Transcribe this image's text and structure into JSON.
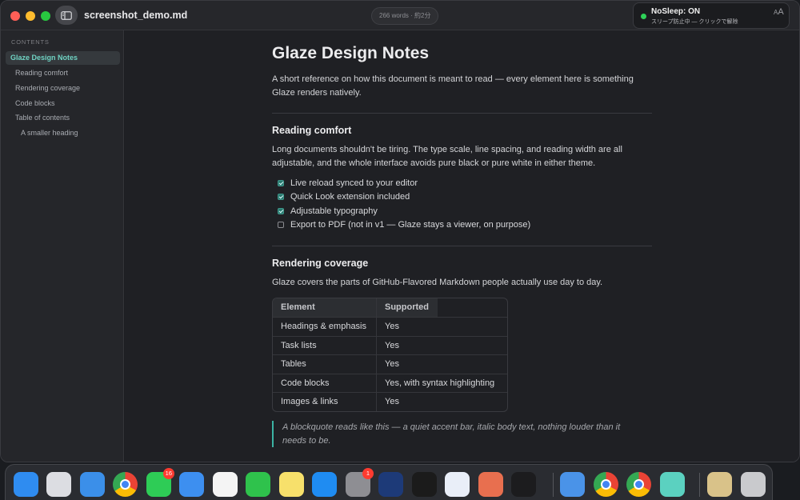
{
  "window": {
    "doc_title": "screenshot_demo.md",
    "word_count": "266 words · 約2分"
  },
  "notification": {
    "title": "NoSleep: ON",
    "subtitle": "スリープ防止中 — クリックで解除",
    "aa_big": "A",
    "aa_small": "A"
  },
  "sidebar": {
    "heading": "CONTENTS",
    "items": [
      {
        "label": "Glaze Design Notes"
      },
      {
        "label": "Reading comfort"
      },
      {
        "label": "Rendering coverage"
      },
      {
        "label": "Code blocks"
      },
      {
        "label": "Table of contents"
      },
      {
        "label": "A smaller heading"
      }
    ]
  },
  "doc": {
    "h1": "Glaze Design Notes",
    "intro_line1": "A short reference on how this document is meant to read — every element here is something",
    "intro_line2": "Glaze renders natively.",
    "reading": {
      "heading": "Reading comfort",
      "para_line1": "Long documents shouldn't be tiring. The type scale, line spacing, and reading width are all",
      "para_line2": "adjustable, and the whole interface avoids pure black or pure white in either theme.",
      "tasks": [
        {
          "label": "Live reload synced to your editor",
          "checked": true
        },
        {
          "label": "Quick Look extension included",
          "checked": true
        },
        {
          "label": "Adjustable typography",
          "checked": true
        },
        {
          "label": "Export to PDF (not in v1 — Glaze stays a viewer, on purpose)",
          "checked": false
        }
      ]
    },
    "rendering": {
      "heading": "Rendering coverage",
      "para": "Glaze covers the parts of GitHub-Flavored Markdown people actually use day to day.",
      "table": {
        "headers": [
          "Element",
          "Supported"
        ],
        "rows": [
          [
            "Headings & emphasis",
            "Yes"
          ],
          [
            "Task lists",
            "Yes"
          ],
          [
            "Tables",
            "Yes"
          ],
          [
            "Code blocks",
            "Yes, with syntax highlighting"
          ],
          [
            "Images & links",
            "Yes"
          ]
        ]
      }
    },
    "quote_line1": "A blockquote reads like this — a quiet accent bar, italic body text, nothing louder than it",
    "quote_line2": "needs to be."
  },
  "dock": {
    "apps": [
      {
        "icon": "finder-icon",
        "color": "#2f8cf0"
      },
      {
        "icon": "launchpad-icon",
        "color": "#dcdde2"
      },
      {
        "icon": "safari-icon",
        "color": "#3b8fe9"
      },
      {
        "icon": "chrome-icon",
        "color": "#e8e8e8"
      },
      {
        "icon": "messages-icon",
        "color": "#2ecc56",
        "badge": "16"
      },
      {
        "icon": "mail-icon",
        "color": "#3d8ff0"
      },
      {
        "icon": "photos-icon",
        "color": "#f4f4f4"
      },
      {
        "icon": "facetime-icon",
        "color": "#2fc24c"
      },
      {
        "icon": "notes-icon",
        "color": "#f7e06b"
      },
      {
        "icon": "app-store-icon",
        "color": "#1f8cf2"
      },
      {
        "icon": "system-settings-icon",
        "color": "#8e8e93",
        "badge": "1"
      },
      {
        "icon": "apple-configurator-icon",
        "color": "#1d3a78"
      },
      {
        "icon": "terminal-icon",
        "color": "#1b1b1b"
      },
      {
        "icon": "1password-icon",
        "color": "#e9eef8"
      },
      {
        "icon": "claude-icon",
        "color": "#e86f4f"
      },
      {
        "icon": "dots-app-icon",
        "color": "#1c1c1e"
      },
      {
        "icon": "xcode-sim-icon",
        "color": "#4a93e8"
      },
      {
        "icon": "chrome-icon-2",
        "color": "#e8e8e8"
      },
      {
        "icon": "chrome-icon-3",
        "color": "#e8e8e8"
      },
      {
        "icon": "glaze-icon",
        "color": "#5bd1c0"
      },
      {
        "icon": "preview-icon",
        "color": "#d9c289"
      },
      {
        "icon": "trash-icon",
        "color": "#c9cacd"
      }
    ]
  }
}
